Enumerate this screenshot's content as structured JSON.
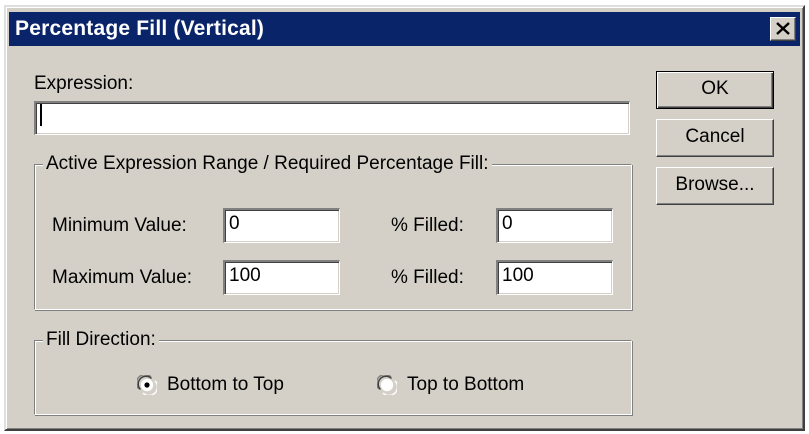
{
  "dialog": {
    "title": "Percentage Fill (Vertical)"
  },
  "expression": {
    "label": "Expression:",
    "value": ""
  },
  "buttons": {
    "ok": "OK",
    "cancel": "Cancel",
    "browse": "Browse..."
  },
  "range_group": {
    "title": "Active Expression Range / Required Percentage Fill:",
    "min_label": "Minimum Value:",
    "min_value": "0",
    "max_label": "Maximum Value:",
    "max_value": "100",
    "min_filled_label": "% Filled:",
    "min_filled_value": "0",
    "max_filled_label": "% Filled:",
    "max_filled_value": "100"
  },
  "direction_group": {
    "title": "Fill Direction:",
    "options": [
      {
        "label": "Bottom to Top",
        "selected": true
      },
      {
        "label": "Top to Bottom",
        "selected": false
      }
    ]
  },
  "colors": {
    "titlebar": "#0a246a",
    "face": "#d4d0c8"
  }
}
